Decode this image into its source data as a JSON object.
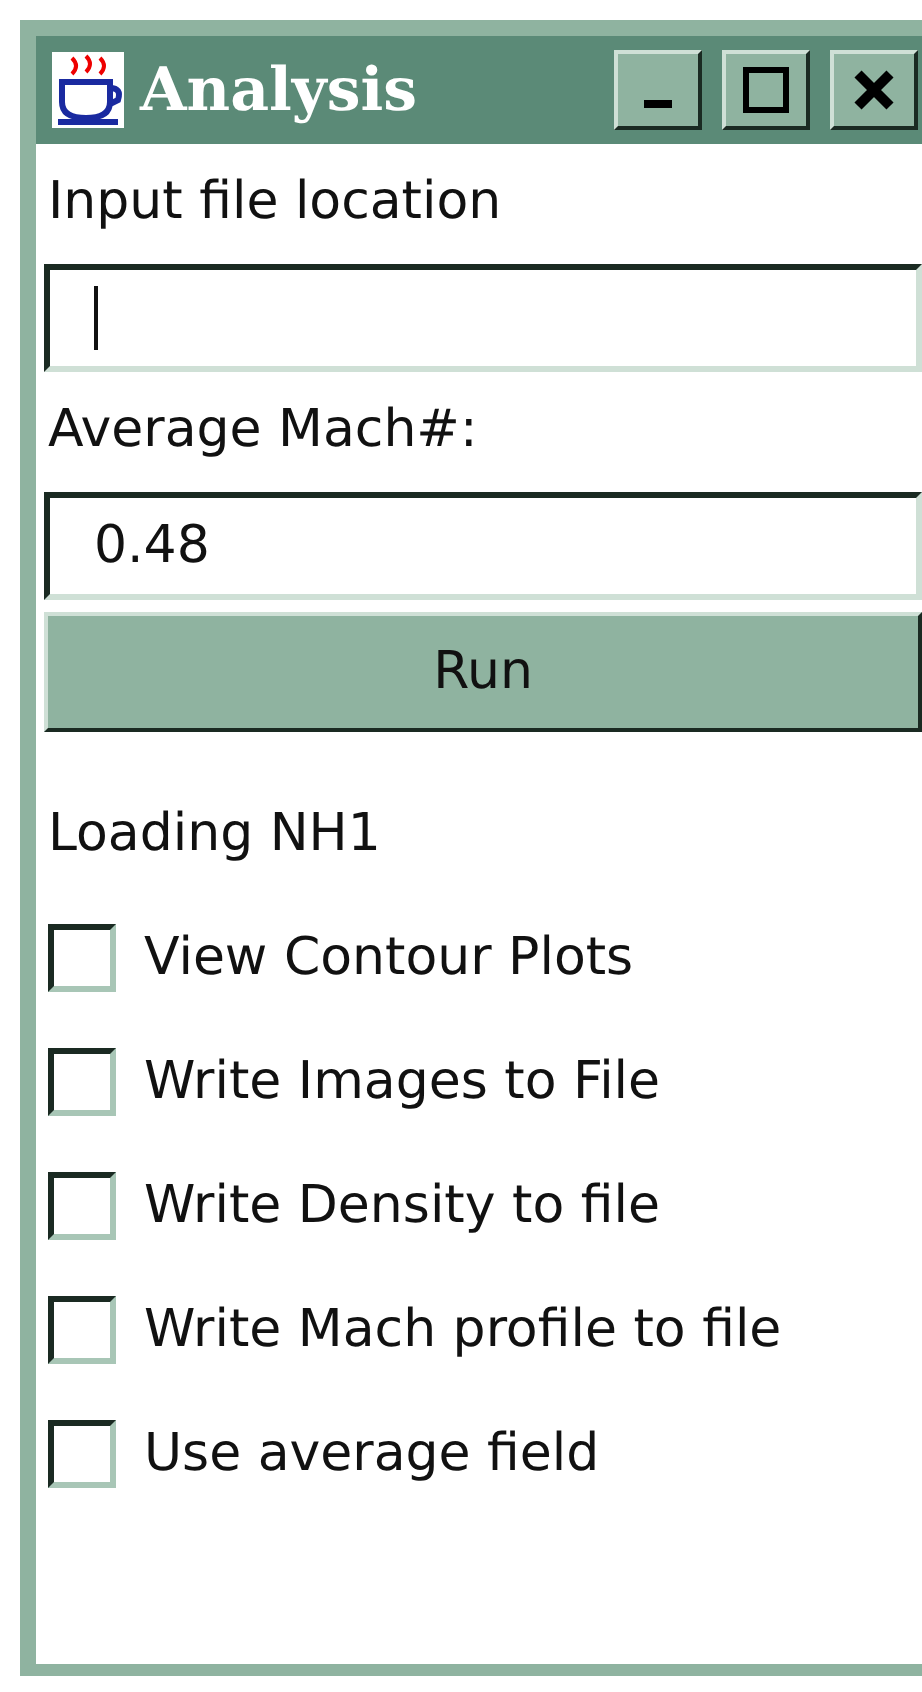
{
  "window": {
    "title": "Analysis"
  },
  "fields": [
    {
      "label": "Input file location",
      "focused": true
    },
    {
      "label": "Average Mach#:",
      "value": "0.48",
      "focused": false
    }
  ],
  "run_button": "Run",
  "status": "Loading NH1",
  "options": [
    {
      "label": "View Contour Plots",
      "checked": false
    },
    {
      "label": "Write Images to File",
      "checked": false
    },
    {
      "label": "Write Density to file",
      "checked": false
    },
    {
      "label": "Write Mach profile to file",
      "checked": false
    },
    {
      "label": "Use average field",
      "checked": false
    }
  ]
}
